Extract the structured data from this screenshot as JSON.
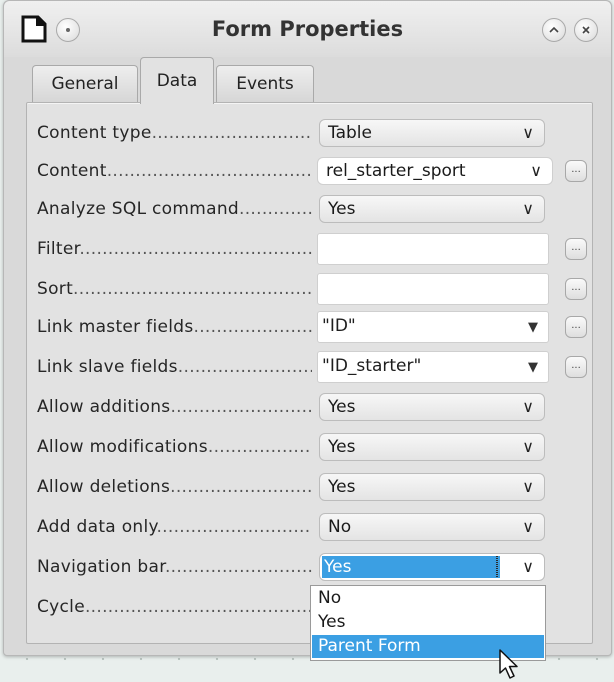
{
  "window": {
    "title": "Form Properties",
    "icons": {
      "app": "form-properties-icon",
      "menu": "window-menu-icon",
      "shade": "chevron-up-icon",
      "close": "close-icon"
    }
  },
  "tabs": [
    {
      "label": "General",
      "active": false
    },
    {
      "label": "Data",
      "active": true
    },
    {
      "label": "Events",
      "active": false
    }
  ],
  "properties": [
    {
      "label": "Content type",
      "value": "Table",
      "control": "combo",
      "icon": "chevron-down-icon"
    },
    {
      "label": "Content",
      "value": "rel_starter_sport",
      "control": "combo",
      "icon": "chevron-down-icon",
      "has_button": true
    },
    {
      "label": "Analyze SQL command",
      "value": "Yes",
      "control": "combo",
      "icon": "chevron-down-icon"
    },
    {
      "label": "Filter",
      "value": "",
      "control": "text",
      "has_button": true
    },
    {
      "label": "Sort",
      "value": "",
      "control": "text",
      "has_button": true
    },
    {
      "label": "Link master fields",
      "value": "\"ID\"",
      "control": "text-dropdown",
      "icon": "triangle-down-icon",
      "has_button": true
    },
    {
      "label": "Link slave fields",
      "value": "\"ID_starter\"",
      "control": "text-dropdown",
      "icon": "triangle-down-icon",
      "has_button": true
    },
    {
      "label": "Allow additions",
      "value": "Yes",
      "control": "combo",
      "icon": "chevron-down-icon"
    },
    {
      "label": "Allow modifications",
      "value": "Yes",
      "control": "combo",
      "icon": "chevron-down-icon"
    },
    {
      "label": "Allow deletions",
      "value": "Yes",
      "control": "combo",
      "icon": "chevron-down-icon"
    },
    {
      "label": "Add data only",
      "value": "No",
      "control": "combo",
      "icon": "chevron-down-icon"
    },
    {
      "label": "Navigation bar",
      "value": "Yes",
      "control": "combo-open",
      "icon": "chevron-down-icon"
    },
    {
      "label": "Cycle",
      "value": "",
      "control": "hidden"
    }
  ],
  "ellipsis_label": "...",
  "chevron_glyph": "∨",
  "triangle_glyph": "▼",
  "dropdown": {
    "options": [
      "No",
      "Yes",
      "Parent Form"
    ],
    "highlighted": "Parent Form"
  },
  "colors": {
    "selection": "#3b9fe3",
    "panel": "#e2e2e2"
  }
}
